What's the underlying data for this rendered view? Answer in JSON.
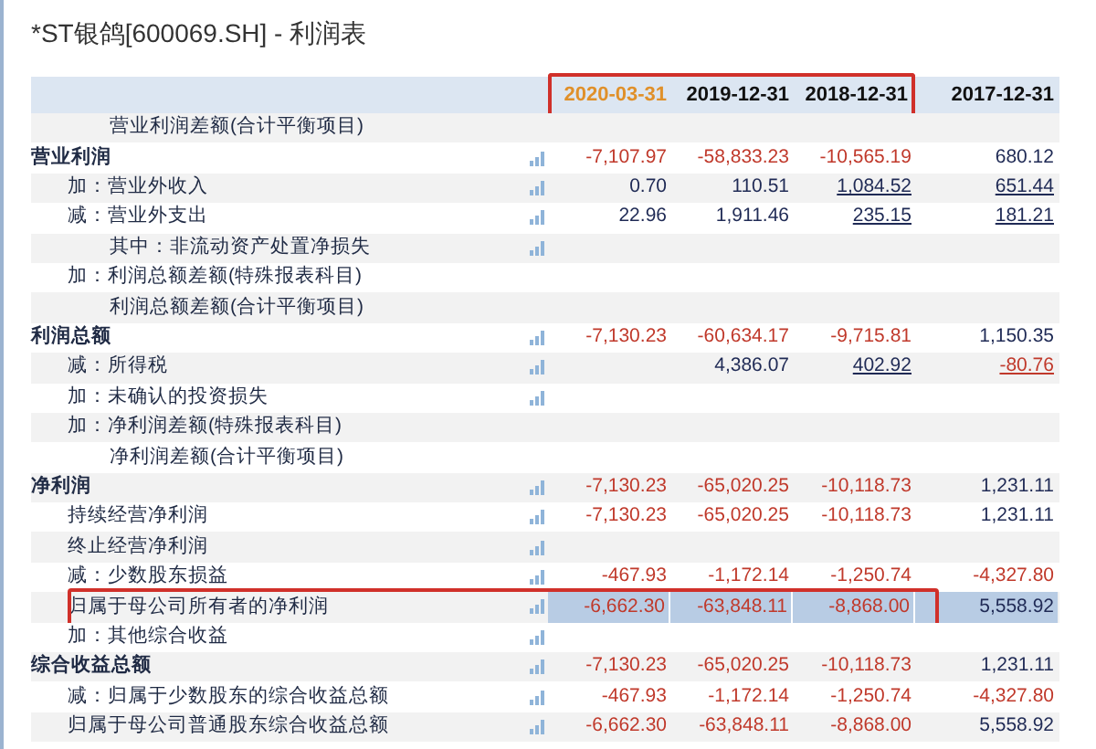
{
  "title": "*ST银鸽[600069.SH] - 利润表",
  "columns": [
    {
      "label": "2020-03-31",
      "accent": true,
      "outlined": true
    },
    {
      "label": "2019-12-31",
      "accent": false,
      "outlined": true
    },
    {
      "label": "2018-12-31",
      "accent": false,
      "outlined": true
    },
    {
      "label": "2017-12-31",
      "accent": false,
      "outlined": false
    }
  ],
  "rows": [
    {
      "label": "营业利润差额(合计平衡项目)",
      "kind": "balance",
      "chart": false,
      "selected": false,
      "cells": []
    },
    {
      "label": "营业利润",
      "kind": "heading",
      "chart": true,
      "selected": false,
      "cells": [
        {
          "text": "-7,107.97",
          "negative": true,
          "linked": false
        },
        {
          "text": "-58,833.23",
          "negative": true,
          "linked": false
        },
        {
          "text": "-10,565.19",
          "negative": true,
          "linked": false
        },
        {
          "text": "680.12",
          "negative": false,
          "linked": false
        }
      ]
    },
    {
      "label": "加：营业外收入",
      "kind": "item",
      "chart": true,
      "selected": false,
      "cells": [
        {
          "text": "0.70",
          "negative": false,
          "linked": false
        },
        {
          "text": "110.51",
          "negative": false,
          "linked": false
        },
        {
          "text": "1,084.52",
          "negative": false,
          "linked": true
        },
        {
          "text": "651.44",
          "negative": false,
          "linked": true
        }
      ]
    },
    {
      "label": "减：营业外支出",
      "kind": "item",
      "chart": true,
      "selected": false,
      "cells": [
        {
          "text": "22.96",
          "negative": false,
          "linked": false
        },
        {
          "text": "1,911.46",
          "negative": false,
          "linked": false
        },
        {
          "text": "235.15",
          "negative": false,
          "linked": true
        },
        {
          "text": "181.21",
          "negative": false,
          "linked": true
        }
      ]
    },
    {
      "label": "其中：非流动资产处置净损失",
      "kind": "balance",
      "chart": true,
      "selected": false,
      "cells": []
    },
    {
      "label": "加：利润总额差额(特殊报表科目)",
      "kind": "item",
      "chart": false,
      "selected": false,
      "cells": []
    },
    {
      "label": "利润总额差额(合计平衡项目)",
      "kind": "balance",
      "chart": false,
      "selected": false,
      "cells": []
    },
    {
      "label": "利润总额",
      "kind": "heading",
      "chart": true,
      "selected": false,
      "cells": [
        {
          "text": "-7,130.23",
          "negative": true,
          "linked": false
        },
        {
          "text": "-60,634.17",
          "negative": true,
          "linked": false
        },
        {
          "text": "-9,715.81",
          "negative": true,
          "linked": false
        },
        {
          "text": "1,150.35",
          "negative": false,
          "linked": false
        }
      ]
    },
    {
      "label": "减：所得税",
      "kind": "item",
      "chart": true,
      "selected": false,
      "cells": [
        null,
        {
          "text": "4,386.07",
          "negative": false,
          "linked": false
        },
        {
          "text": "402.92",
          "negative": false,
          "linked": true
        },
        {
          "text": "-80.76",
          "negative": true,
          "linked": true
        }
      ]
    },
    {
      "label": "加：未确认的投资损失",
      "kind": "item",
      "chart": true,
      "selected": false,
      "cells": []
    },
    {
      "label": "加：净利润差额(特殊报表科目)",
      "kind": "item",
      "chart": false,
      "selected": false,
      "cells": []
    },
    {
      "label": "净利润差额(合计平衡项目)",
      "kind": "balance",
      "chart": false,
      "selected": false,
      "cells": []
    },
    {
      "label": "净利润",
      "kind": "heading",
      "chart": true,
      "selected": false,
      "cells": [
        {
          "text": "-7,130.23",
          "negative": true,
          "linked": false
        },
        {
          "text": "-65,020.25",
          "negative": true,
          "linked": false
        },
        {
          "text": "-10,118.73",
          "negative": true,
          "linked": false
        },
        {
          "text": "1,231.11",
          "negative": false,
          "linked": false
        }
      ]
    },
    {
      "label": "持续经营净利润",
      "kind": "item",
      "chart": true,
      "selected": false,
      "cells": [
        {
          "text": "-7,130.23",
          "negative": true,
          "linked": false
        },
        {
          "text": "-65,020.25",
          "negative": true,
          "linked": false
        },
        {
          "text": "-10,118.73",
          "negative": true,
          "linked": false
        },
        {
          "text": "1,231.11",
          "negative": false,
          "linked": false
        }
      ]
    },
    {
      "label": "终止经营净利润",
      "kind": "item",
      "chart": true,
      "selected": false,
      "cells": []
    },
    {
      "label": "减：少数股东损益",
      "kind": "item",
      "chart": true,
      "selected": false,
      "cells": [
        {
          "text": "-467.93",
          "negative": true,
          "linked": false
        },
        {
          "text": "-1,172.14",
          "negative": true,
          "linked": false
        },
        {
          "text": "-1,250.74",
          "negative": true,
          "linked": false
        },
        {
          "text": "-4,327.80",
          "negative": true,
          "linked": false
        }
      ]
    },
    {
      "label": "归属于母公司所有者的净利润",
      "kind": "item",
      "chart": true,
      "selected": true,
      "cells": [
        {
          "text": "-6,662.30",
          "negative": true,
          "linked": false
        },
        {
          "text": "-63,848.11",
          "negative": true,
          "linked": false
        },
        {
          "text": "-8,868.00",
          "negative": true,
          "linked": false
        },
        {
          "text": "5,558.92",
          "negative": false,
          "linked": false
        }
      ]
    },
    {
      "label": "加：其他综合收益",
      "kind": "item",
      "chart": true,
      "selected": false,
      "cells": []
    },
    {
      "label": "综合收益总额",
      "kind": "heading",
      "chart": true,
      "selected": false,
      "cells": [
        {
          "text": "-7,130.23",
          "negative": true,
          "linked": false
        },
        {
          "text": "-65,020.25",
          "negative": true,
          "linked": false
        },
        {
          "text": "-10,118.73",
          "negative": true,
          "linked": false
        },
        {
          "text": "1,231.11",
          "negative": false,
          "linked": false
        }
      ]
    },
    {
      "label": "减：归属于少数股东的综合收益总额",
      "kind": "item",
      "chart": true,
      "selected": false,
      "cells": [
        {
          "text": "-467.93",
          "negative": true,
          "linked": false
        },
        {
          "text": "-1,172.14",
          "negative": true,
          "linked": false
        },
        {
          "text": "-1,250.74",
          "negative": true,
          "linked": false
        },
        {
          "text": "-4,327.80",
          "negative": true,
          "linked": false
        }
      ]
    },
    {
      "label": "归属于母公司普通股东综合收益总额",
      "kind": "item",
      "chart": true,
      "selected": false,
      "cells": [
        {
          "text": "-6,662.30",
          "negative": true,
          "linked": false
        },
        {
          "text": "-63,848.11",
          "negative": true,
          "linked": false
        },
        {
          "text": "-8,868.00",
          "negative": true,
          "linked": false
        },
        {
          "text": "5,558.92",
          "negative": false,
          "linked": false
        }
      ]
    }
  ]
}
